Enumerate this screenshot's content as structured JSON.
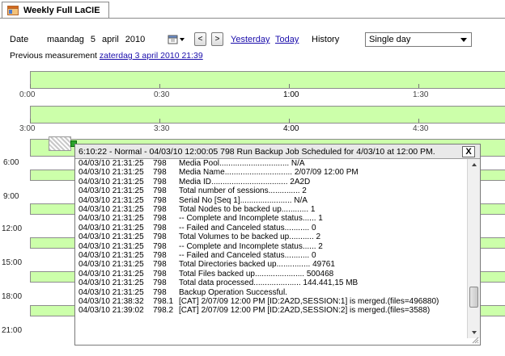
{
  "tab": {
    "title": "Weekly Full LaCIE"
  },
  "controls": {
    "date_label": "Date",
    "day_name": "maandag",
    "day": "5",
    "month": "april",
    "year": "2010",
    "prev_btn": "<",
    "next_btn": ">",
    "yesterday": "Yesterday",
    "today": "Today",
    "history_label": "History",
    "history_value": "Single day"
  },
  "previous": {
    "label": "Previous measurement",
    "link": "zaterdag 3 april 2010 21:39"
  },
  "timeline": {
    "row1_labels": [
      "0:00",
      "0:30",
      "1:00",
      "1:30"
    ],
    "row2_labels": [
      "3:00",
      "3:30",
      "4:00",
      "4:30"
    ],
    "left_labels": [
      "6:00",
      "9:00",
      "12:00",
      "15:00",
      "18:00",
      "21:00"
    ]
  },
  "popup": {
    "title": "6:10:22 - Normal - 04/03/10 12:00:05   798        Run Backup Job Scheduled for  4/03/10 at 12:00 PM.",
    "close": "X",
    "lines": [
      {
        "ts": "04/03/10 21:31:25",
        "id": "798",
        "msg": "Media Pool............................... N/A"
      },
      {
        "ts": "04/03/10 21:31:25",
        "id": "798",
        "msg": "Media Name.............................. 2/07/09 12:00 PM"
      },
      {
        "ts": "04/03/10 21:31:25",
        "id": "798",
        "msg": "Media ID.................................. 2A2D"
      },
      {
        "ts": "04/03/10 21:31:25",
        "id": "798",
        "msg": "Total number of sessions.............. 2"
      },
      {
        "ts": "04/03/10 21:31:25",
        "id": "798",
        "msg": "Serial No [Seq 1]....................... N/A"
      },
      {
        "ts": "04/03/10 21:31:25",
        "id": "798",
        "msg": "Total Nodes to be backed up............ 1"
      },
      {
        "ts": "04/03/10 21:31:25",
        "id": "798",
        "msg": "-- Complete and Incomplete status...... 1"
      },
      {
        "ts": "04/03/10 21:31:25",
        "id": "798",
        "msg": "-- Failed and Canceled status........... 0"
      },
      {
        "ts": "04/03/10 21:31:25",
        "id": "798",
        "msg": "Total Volumes to be backed up........... 2"
      },
      {
        "ts": "04/03/10 21:31:25",
        "id": "798",
        "msg": "-- Complete and Incomplete status...... 2"
      },
      {
        "ts": "04/03/10 21:31:25",
        "id": "798",
        "msg": "-- Failed and Canceled status........... 0"
      },
      {
        "ts": "04/03/10 21:31:25",
        "id": "798",
        "msg": "Total Directories backed up............... 49761"
      },
      {
        "ts": "04/03/10 21:31:25",
        "id": "798",
        "msg": "Total Files backed up...................... 500468"
      },
      {
        "ts": "04/03/10 21:31:25",
        "id": "798",
        "msg": "Total data processed..................... 144.441,15 MB"
      },
      {
        "ts": "04/03/10 21:31:25",
        "id": "798",
        "msg": "Backup Operation Successful."
      },
      {
        "ts": "04/03/10 21:38:32",
        "id": "798.1",
        "msg": "[CAT] 2/07/09 12:00 PM [ID:2A2D,SESSION:1] is merged.(files=496880)"
      },
      {
        "ts": "04/03/10 21:39:02",
        "id": "798.2",
        "msg": "[CAT] 2/07/09 12:00 PM [ID:2A2D,SESSION:2] is merged.(files=3588)"
      }
    ]
  }
}
